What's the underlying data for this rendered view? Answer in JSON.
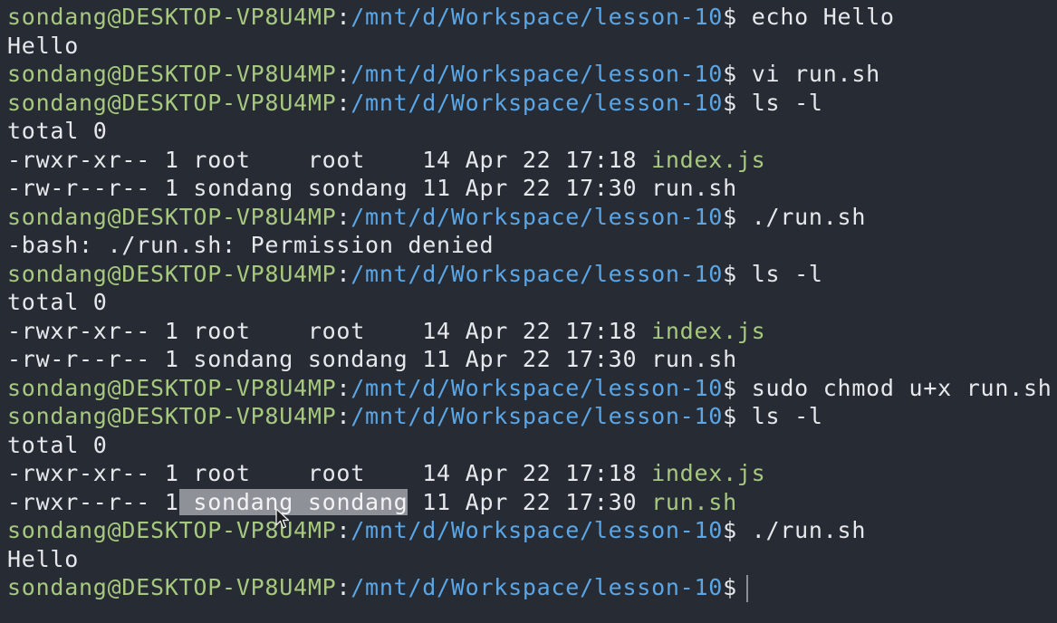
{
  "prompt": {
    "user_host": "sondang@DESKTOP-VP8U4MP",
    "path": "/mnt/d/Workspace/lesson-10",
    "symbol": "$"
  },
  "lines": [
    {
      "type": "prompt",
      "cmd": "echo Hello"
    },
    {
      "type": "out",
      "text": "Hello"
    },
    {
      "type": "prompt",
      "cmd": "vi run.sh"
    },
    {
      "type": "prompt",
      "cmd": "ls -l"
    },
    {
      "type": "out",
      "text": "total 0"
    },
    {
      "type": "ls",
      "perm": "-rwxr-xr-- 1 ",
      "owner": "root    root    ",
      "meta": "14 Apr 22 17:18 ",
      "name": "index.js",
      "exec": true
    },
    {
      "type": "ls",
      "perm": "-rw-r--r-- 1 ",
      "owner": "sondang sondang ",
      "meta": "11 Apr 22 17:30 ",
      "name": "run.sh",
      "exec": false
    },
    {
      "type": "prompt",
      "cmd": "./run.sh"
    },
    {
      "type": "out",
      "text": "-bash: ./run.sh: Permission denied"
    },
    {
      "type": "prompt",
      "cmd": "ls -l"
    },
    {
      "type": "out",
      "text": "total 0"
    },
    {
      "type": "ls",
      "perm": "-rwxr-xr-- 1 ",
      "owner": "root    root    ",
      "meta": "14 Apr 22 17:18 ",
      "name": "index.js",
      "exec": true
    },
    {
      "type": "ls",
      "perm": "-rw-r--r-- 1 ",
      "owner": "sondang sondang ",
      "meta": "11 Apr 22 17:30 ",
      "name": "run.sh",
      "exec": false
    },
    {
      "type": "prompt",
      "cmd": "sudo chmod u+x run.sh"
    },
    {
      "type": "prompt",
      "cmd": "ls -l"
    },
    {
      "type": "out",
      "text": "total 0"
    },
    {
      "type": "ls",
      "perm": "-rwxr-xr-- 1 ",
      "owner": "root    root    ",
      "meta": "14 Apr 22 17:18 ",
      "name": "index.js",
      "exec": true
    },
    {
      "type": "ls",
      "perm": "-rwxr--r-- 1",
      "owner": " sondang sondang",
      "meta": " 11 Apr 22 17:30 ",
      "name": "run.sh",
      "exec": true,
      "selected": true
    },
    {
      "type": "prompt",
      "cmd": "./run.sh"
    },
    {
      "type": "out",
      "text": "Hello"
    },
    {
      "type": "prompt",
      "cmd": "",
      "cursor": true
    }
  ],
  "colors": {
    "background": "#272b34",
    "user_host": "#a7c97f",
    "path": "#5aa6e6",
    "text": "#e6e8ec",
    "executable": "#a7c97f",
    "selection": "#8e9197"
  },
  "icons": {
    "mouse": "mouse-pointer-icon"
  }
}
